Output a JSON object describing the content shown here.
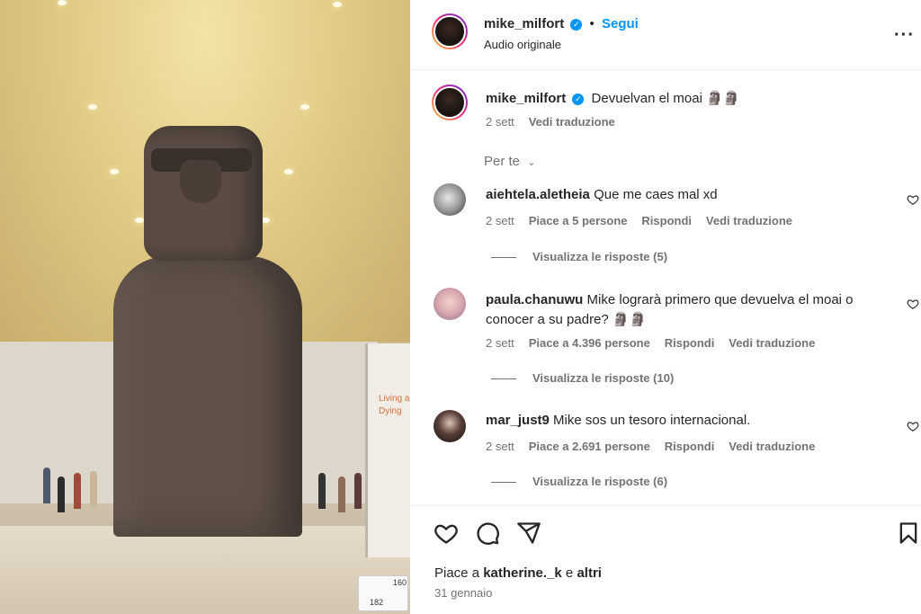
{
  "post": {
    "author": "mike_milfort",
    "follow_label": "Segui",
    "audio_label": "Audio originale",
    "caption_author": "mike_milfort",
    "caption_text": "Devuelvan el moai 🗿🗿",
    "caption_time": "2 sett",
    "caption_translate": "Vedi traduzione",
    "filter_label": "Per te",
    "likes_prefix": "Piace a ",
    "likes_user": "katherine._k",
    "likes_join": " e ",
    "likes_others": "altri",
    "date": "31 gennaio"
  },
  "photo": {
    "sign_line1": "Living a",
    "sign_line2": "Dying",
    "sticker_a": "182",
    "sticker_b": "160"
  },
  "comments": [
    {
      "user": "aiehtela.aletheia",
      "text": "Que me caes mal xd",
      "time": "2 sett",
      "likes": "Piace a 5 persone",
      "reply": "Rispondi",
      "translate": "Vedi traduzione",
      "replies": "Visualizza le risposte (5)"
    },
    {
      "user": "paula.chanuwu",
      "text": "Mike lograrà primero que devuelva el moai o",
      "text2": "conocer a su padre? 🗿🗿",
      "time": "2 sett",
      "likes": "Piace a 4.396 persone",
      "reply": "Rispondi",
      "translate": "Vedi traduzione",
      "replies": "Visualizza le risposte (10)"
    },
    {
      "user": "mar_just9",
      "text": "Mike sos un tesoro internacional.",
      "time": "2 sett",
      "likes": "Piace a 2.691 persone",
      "reply": "Rispondi",
      "translate": "Vedi traduzione",
      "replies": "Visualizza le risposte (6)"
    }
  ],
  "icons": {
    "more": "more-horizontal-icon",
    "like": "heart-icon",
    "comment": "comment-icon",
    "share": "send-icon",
    "save": "bookmark-icon",
    "verified": "verified-badge-icon"
  },
  "colors": {
    "accent": "#0095f6",
    "muted": "#737373",
    "text": "#262626"
  }
}
